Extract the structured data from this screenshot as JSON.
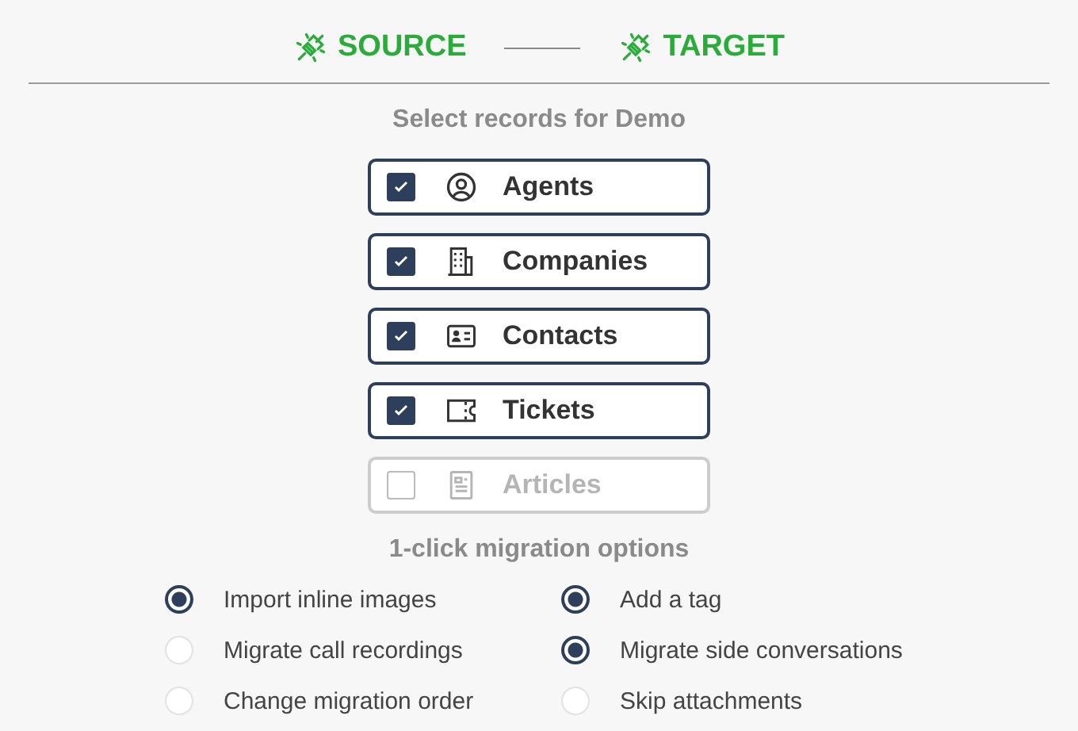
{
  "steps": [
    {
      "label": "SOURCE"
    },
    {
      "label": "TARGET"
    }
  ],
  "records": {
    "title": "Select records for Demo",
    "items": [
      {
        "kind": "person",
        "label": "Agents",
        "checked": true,
        "disabled": false
      },
      {
        "kind": "building",
        "label": "Companies",
        "checked": true,
        "disabled": false
      },
      {
        "kind": "card",
        "label": "Contacts",
        "checked": true,
        "disabled": false
      },
      {
        "kind": "ticket",
        "label": "Tickets",
        "checked": true,
        "disabled": false
      },
      {
        "kind": "document",
        "label": "Articles",
        "checked": false,
        "disabled": true
      }
    ]
  },
  "options": {
    "title": "1-click migration options",
    "items": [
      {
        "label": "Import inline images",
        "checked": true
      },
      {
        "label": "Add a tag",
        "checked": true
      },
      {
        "label": "Migrate call recordings",
        "checked": false
      },
      {
        "label": "Migrate side conversations",
        "checked": true
      },
      {
        "label": "Change migration order",
        "checked": false
      },
      {
        "label": "Skip attachments",
        "checked": false
      }
    ]
  }
}
